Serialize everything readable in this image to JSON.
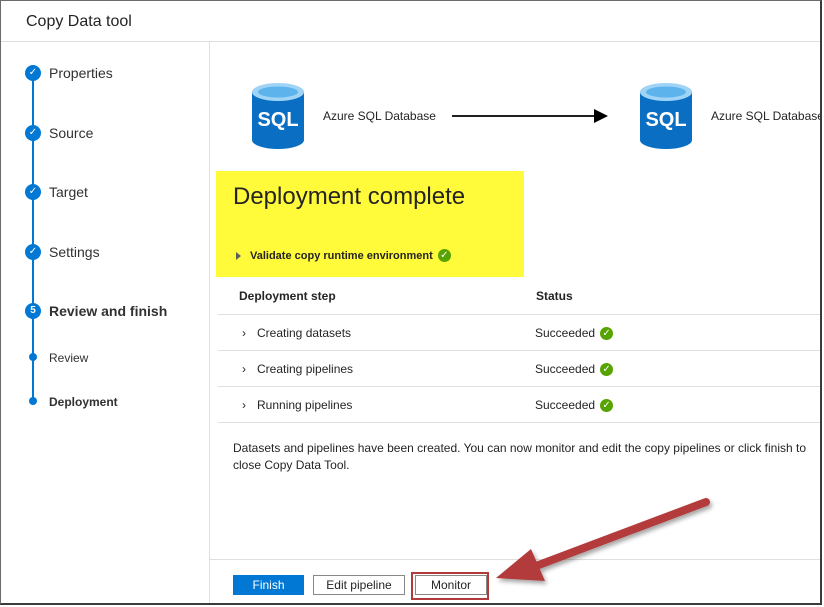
{
  "window": {
    "title": "Copy Data tool"
  },
  "sidebar": {
    "steps": [
      {
        "label": "Properties",
        "marker": "✓"
      },
      {
        "label": "Source",
        "marker": "✓"
      },
      {
        "label": "Target",
        "marker": "✓"
      },
      {
        "label": "Settings",
        "marker": "✓"
      },
      {
        "label": "Review and finish",
        "marker": "5"
      },
      {
        "label": "Review",
        "marker": ""
      },
      {
        "label": "Deployment",
        "marker": ""
      }
    ]
  },
  "flow": {
    "source_icon_text": "SQL",
    "source_label": "Azure SQL Database",
    "target_icon_text": "SQL",
    "target_label": "Azure SQL Database"
  },
  "deployment": {
    "headline": "Deployment complete",
    "validate_label": "Validate copy runtime environment",
    "check_glyph": "✓"
  },
  "table": {
    "headers": {
      "step": "Deployment step",
      "status": "Status"
    },
    "rows": [
      {
        "chevron": "›",
        "step": "Creating datasets",
        "status": "Succeeded"
      },
      {
        "chevron": "›",
        "step": "Creating pipelines",
        "status": "Succeeded"
      },
      {
        "chevron": "›",
        "step": "Running pipelines",
        "status": "Succeeded"
      }
    ]
  },
  "message": "Datasets and pipelines have been created. You can now monitor and edit the copy pipelines or click finish to close Copy Data Tool.",
  "footer": {
    "finish_label": "Finish",
    "edit_label": "Edit pipeline",
    "monitor_label": "Monitor"
  },
  "colors": {
    "accent": "#0078d4",
    "highlight": "#fffb3a",
    "success": "#57a300",
    "annotation_arrow": "#b33a3a"
  }
}
